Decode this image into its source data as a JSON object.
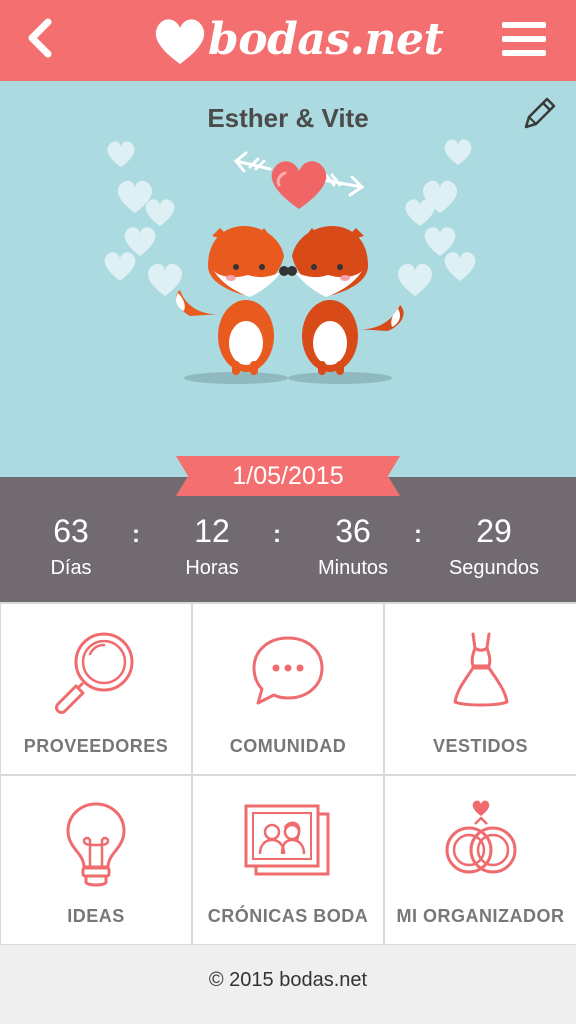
{
  "header": {
    "logo_text": "bodas.net",
    "back_icon": "chevron-left-icon",
    "menu_icon": "hamburger-menu-icon",
    "color": "#f46f6f"
  },
  "hero": {
    "couple_name": "Esther & Vite",
    "edit_icon": "pencil-icon",
    "background": "#abdbe0",
    "illustration": "two-foxes-heart-illustration"
  },
  "wedding_date": "1/05/2015",
  "countdown": {
    "separator": ":",
    "items": [
      {
        "value": "63",
        "label": "Días"
      },
      {
        "value": "12",
        "label": "Horas"
      },
      {
        "value": "36",
        "label": "Minutos"
      },
      {
        "value": "29",
        "label": "Segundos"
      }
    ]
  },
  "menu": {
    "items": [
      {
        "label": "PROVEEDORES",
        "icon": "magnifier-icon"
      },
      {
        "label": "COMUNIDAD",
        "icon": "chat-bubble-icon"
      },
      {
        "label": "VESTIDOS",
        "icon": "dress-icon"
      },
      {
        "label": "IDEAS",
        "icon": "lightbulb-icon"
      },
      {
        "label": "CRÓNICAS BODA",
        "icon": "photo-frames-icon"
      },
      {
        "label": "MI ORGANIZADOR",
        "icon": "wedding-rings-icon"
      }
    ]
  },
  "footer": {
    "text": "© 2015 bodas.net"
  },
  "colors": {
    "accent": "#f46f6f",
    "countdown_bg": "#726a71",
    "icon_stroke": "#ef6b6e",
    "label_gray": "#777777"
  }
}
